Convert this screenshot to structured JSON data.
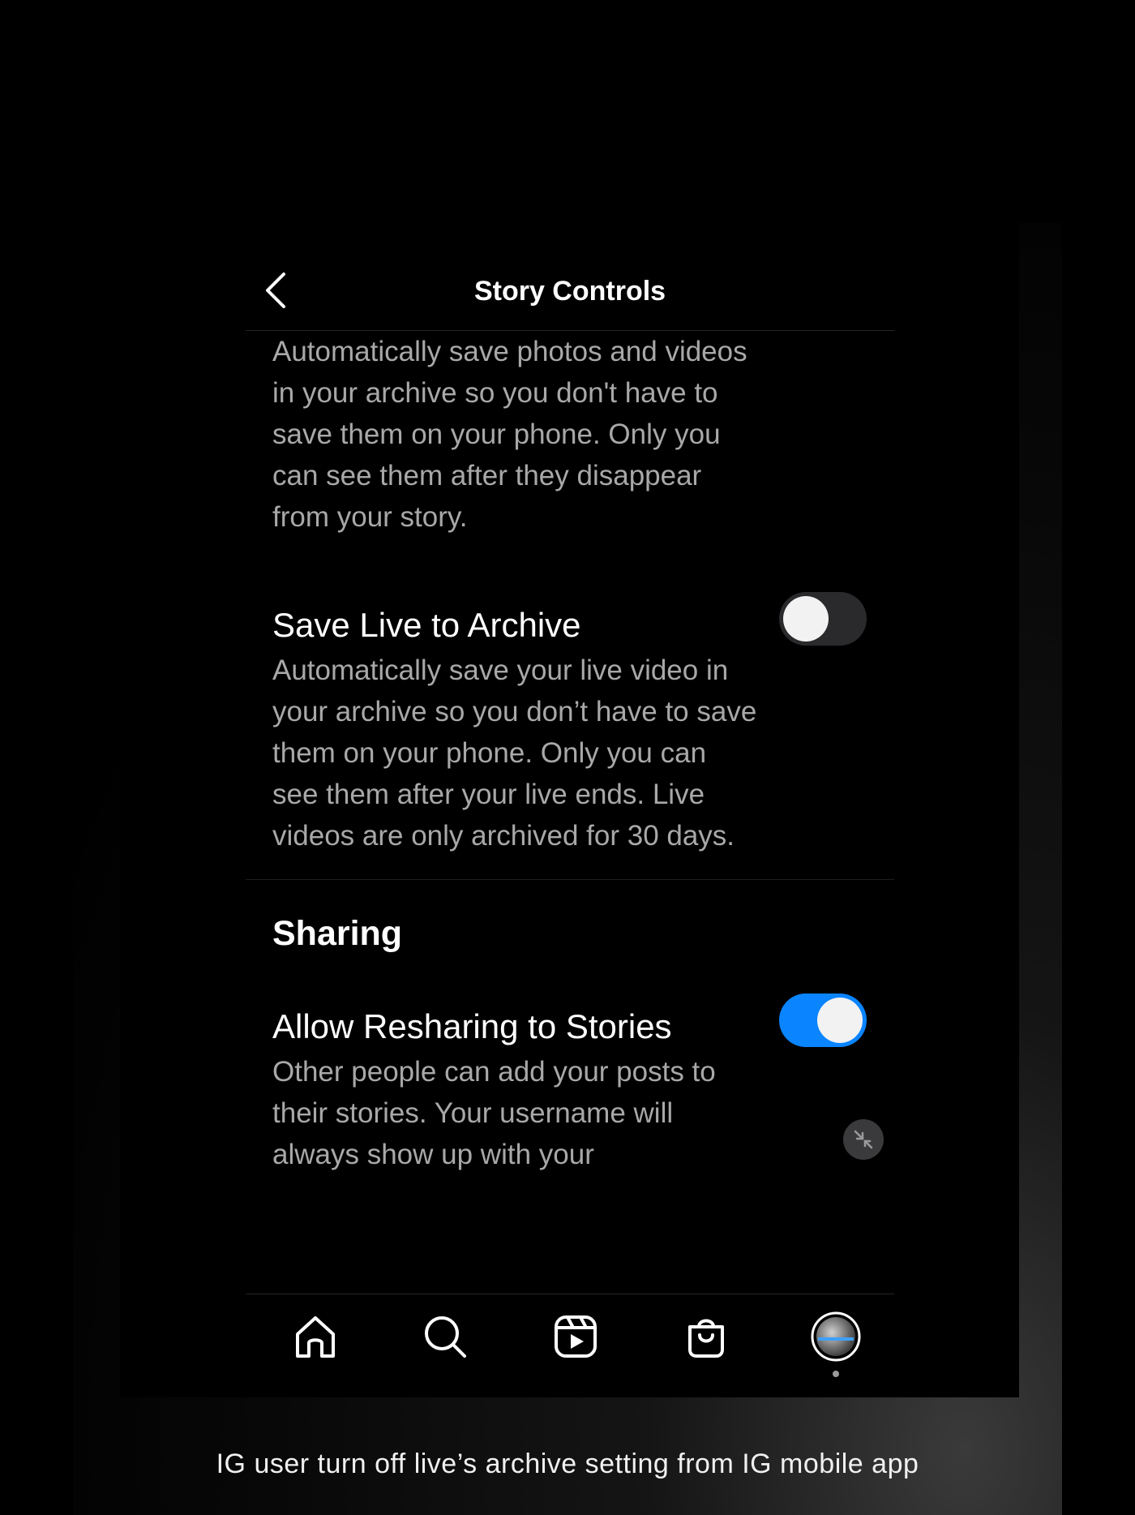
{
  "header": {
    "title": "Story Controls"
  },
  "archive_section": {
    "story_archive_description": "Automatically save photos and videos in your archive so you don't have to save them on your phone. Only you can see them after they disappear from your story."
  },
  "live_archive": {
    "title": "Save Live to Archive",
    "description": "Automatically save your live video in your archive so you don’t have to save them on your phone. Only you can see them after your live ends. Live videos are only archived for 30 days.",
    "enabled": false
  },
  "sharing": {
    "section_title": "Sharing",
    "resharing": {
      "title": "Allow Resharing to Stories",
      "description": "Other people can add your posts to their stories. Your username will always show up with your",
      "enabled": true,
      "accent_color": "#0a84ff"
    }
  },
  "tabbar": {
    "items": [
      "home-icon",
      "search-icon",
      "reels-icon",
      "shop-icon",
      "profile-avatar"
    ]
  },
  "caption": "IG user turn off live’s archive setting from IG mobile app"
}
